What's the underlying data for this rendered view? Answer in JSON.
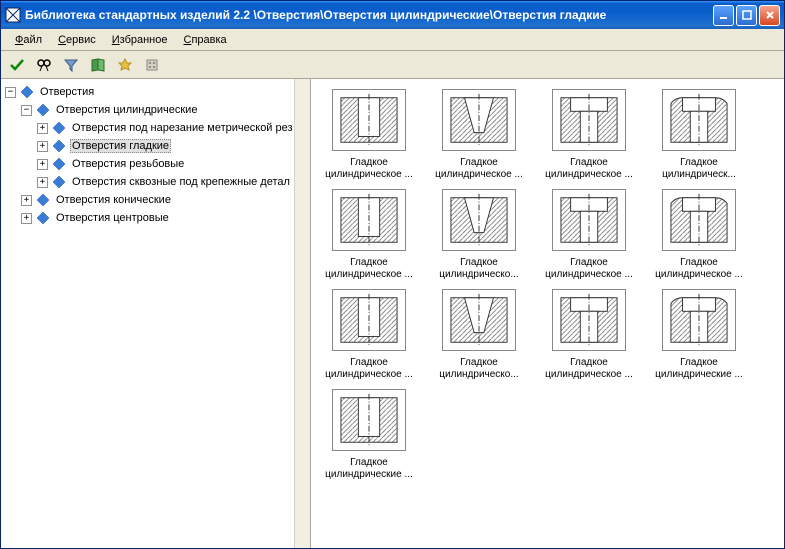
{
  "window": {
    "title": "Библиотека стандартных изделий 2.2 \\Отверстия\\Отверстия цилиндрические\\Отверстия гладкие"
  },
  "menu": {
    "file": "Файл",
    "service": "Сервис",
    "favorites": "Избранное",
    "help": "Справка"
  },
  "tree": {
    "root": "Отверстия",
    "n1": "Отверстия цилиндрические",
    "n1a": "Отверстия под нарезание метрической рез",
    "n1b": "Отверстия гладкие",
    "n1c": "Отверстия резьбовые",
    "n1d": "Отверстия сквозные под крепежные детал",
    "n2": "Отверстия конические",
    "n3": "Отверстия центровые"
  },
  "items": [
    {
      "l1": "Гладкое",
      "l2": "цилиндрическое ..."
    },
    {
      "l1": "Гладкое",
      "l2": "цилиндрическое ..."
    },
    {
      "l1": "Гладкое",
      "l2": "цилиндрическое ..."
    },
    {
      "l1": "Гладкое",
      "l2": "цилиндрическ..."
    },
    {
      "l1": "Гладкое",
      "l2": "цилиндрическое ..."
    },
    {
      "l1": "Гладкое",
      "l2": "цилиндрическо..."
    },
    {
      "l1": "Гладкое",
      "l2": "цилиндрическое ..."
    },
    {
      "l1": "Гладкое",
      "l2": "цилиндрическое ..."
    },
    {
      "l1": "Гладкое",
      "l2": "цилиндрическое ..."
    },
    {
      "l1": "Гладкое",
      "l2": "цилиндрическо..."
    },
    {
      "l1": "Гладкое",
      "l2": "цилиндрическое ..."
    },
    {
      "l1": "Гладкое",
      "l2": "цилиндрические ..."
    },
    {
      "l1": "Гладкое",
      "l2": "цилиндрические ..."
    }
  ]
}
